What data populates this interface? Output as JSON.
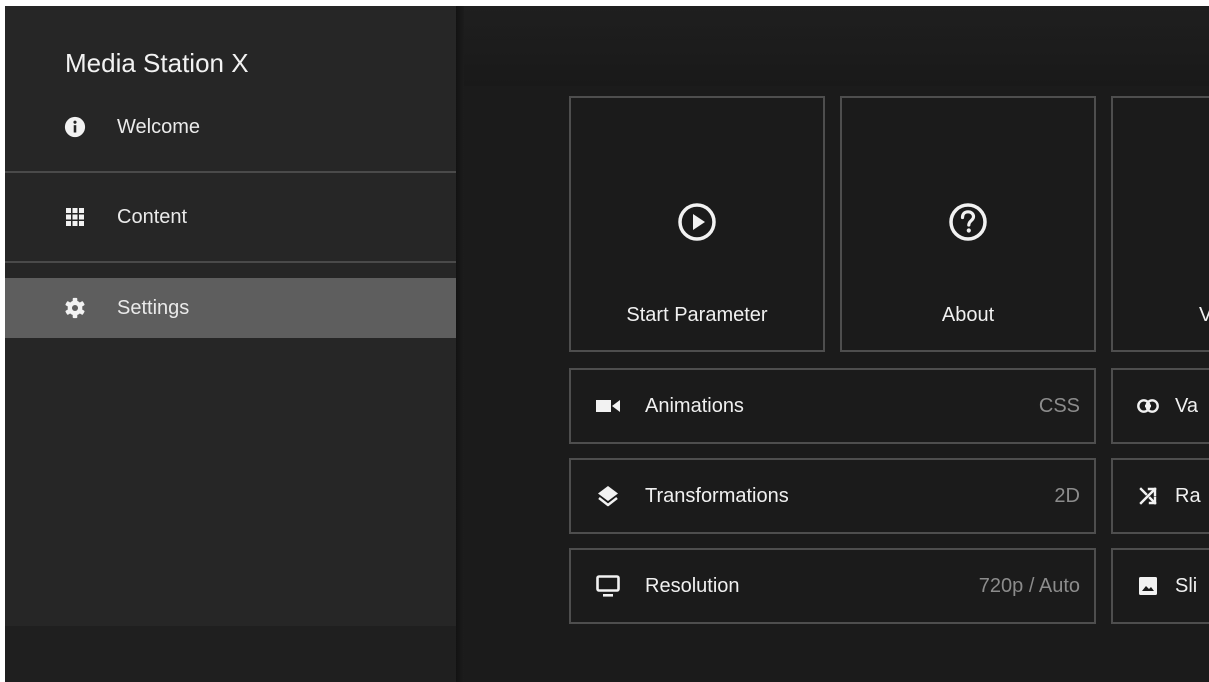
{
  "sidebar": {
    "title": "Media Station X",
    "items": [
      {
        "label": "Welcome",
        "icon": "info-icon"
      },
      {
        "label": "Content",
        "icon": "grid-icon"
      },
      {
        "label": "Settings",
        "icon": "gear-icon",
        "active": true
      }
    ]
  },
  "main": {
    "tiles": [
      {
        "label": "Start Parameter",
        "icon": "play-circle-icon"
      },
      {
        "label": "About",
        "icon": "help-circle-icon"
      },
      {
        "label": "V",
        "icon": ""
      }
    ],
    "rows_left": [
      {
        "label": "Animations",
        "value": "CSS",
        "icon": "video-camera-icon"
      },
      {
        "label": "Transformations",
        "value": "2D",
        "icon": "layers-icon"
      },
      {
        "label": "Resolution",
        "value": "720p / Auto",
        "icon": "monitor-icon"
      }
    ],
    "rows_right": [
      {
        "label": "Va",
        "icon": "link-icon"
      },
      {
        "label": "Ra",
        "icon": "shuffle-icon"
      },
      {
        "label": "Sli",
        "icon": "image-icon"
      }
    ]
  },
  "colors": {
    "sidebar_bg": "#262626",
    "active_item_bg": "#5e5e5e",
    "main_bg": "#1b1b1b",
    "tile_border": "#4e4e4e",
    "value_text": "#8c8c8c"
  }
}
